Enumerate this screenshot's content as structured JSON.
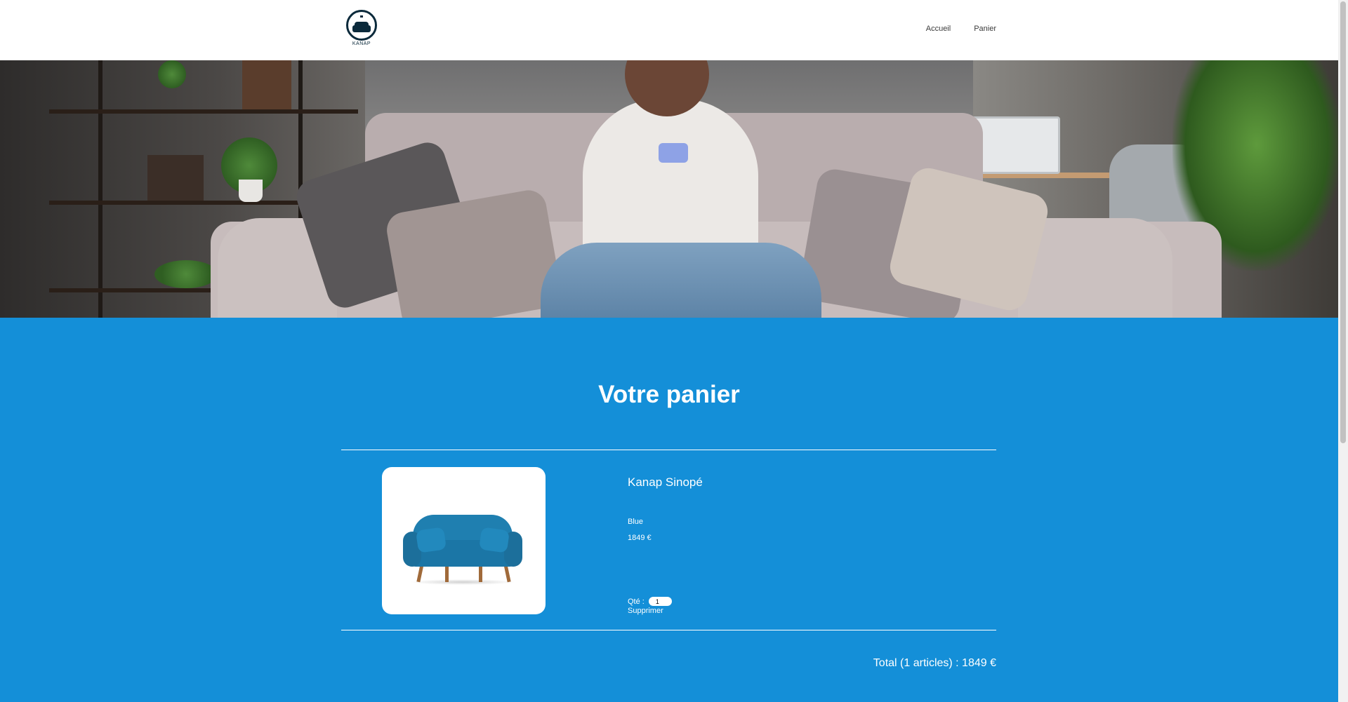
{
  "header": {
    "logo_text": "KANAP",
    "nav": {
      "home": "Accueil",
      "cart": "Panier"
    }
  },
  "cart": {
    "title": "Votre panier",
    "items": [
      {
        "name": "Kanap Sinopé",
        "color": "Blue",
        "price": "1849 €",
        "qty_label": "Qté :",
        "qty_value": "1",
        "delete_label": "Supprimer",
        "image_alt": "blue-sofa"
      }
    ],
    "total": "Total (1 articles) : 1849 €"
  },
  "colors": {
    "accent": "#148fd8",
    "text_on_accent": "#ffffff",
    "logo": "#0b2a3b"
  }
}
